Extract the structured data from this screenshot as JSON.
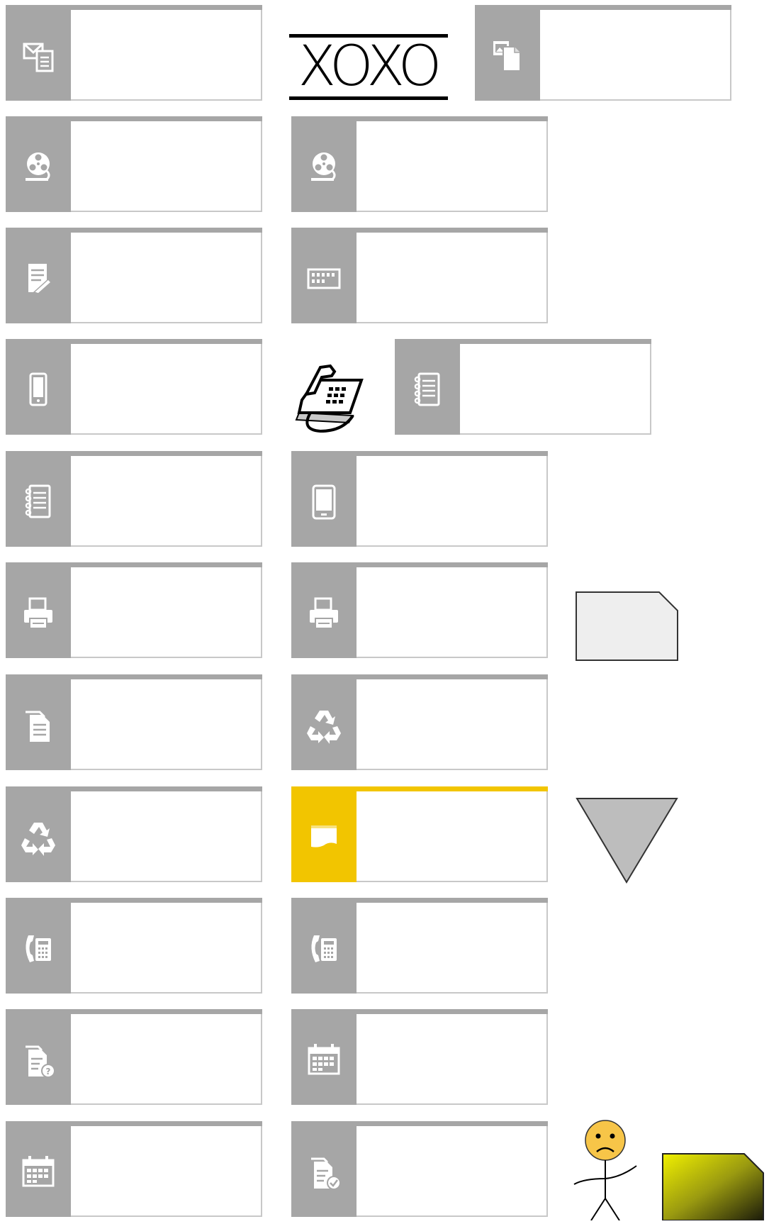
{
  "logo": {
    "text": "XOXO"
  },
  "tiles": [
    {
      "icon": "mail-doc-icon"
    },
    {
      "icon": "picture-doc-icon"
    },
    {
      "icon": "film-reel-icon"
    },
    {
      "icon": "film-reel-icon"
    },
    {
      "icon": "note-edit-icon"
    },
    {
      "icon": "keyboard-icon"
    },
    {
      "icon": "mobile-phone-icon"
    },
    {
      "icon": "notebook-icon"
    },
    {
      "icon": "notebook-icon"
    },
    {
      "icon": "tablet-icon"
    },
    {
      "icon": "printer-icon"
    },
    {
      "icon": "printer-icon"
    },
    {
      "icon": "document-stack-icon"
    },
    {
      "icon": "recycle-icon"
    },
    {
      "icon": "recycle-icon"
    },
    {
      "icon": "card-icon",
      "highlight": true
    },
    {
      "icon": "fax-phone-icon"
    },
    {
      "icon": "fax-phone-icon"
    },
    {
      "icon": "document-question-icon"
    },
    {
      "icon": "calendar-icon"
    },
    {
      "icon": "calendar-icon"
    },
    {
      "icon": "document-check-icon"
    }
  ],
  "colors": {
    "tile_gray": "#a6a6a6",
    "tile_highlight": "#f2c500",
    "shape_gray": "#bdbdbd",
    "face_yellow": "#f7c548"
  }
}
